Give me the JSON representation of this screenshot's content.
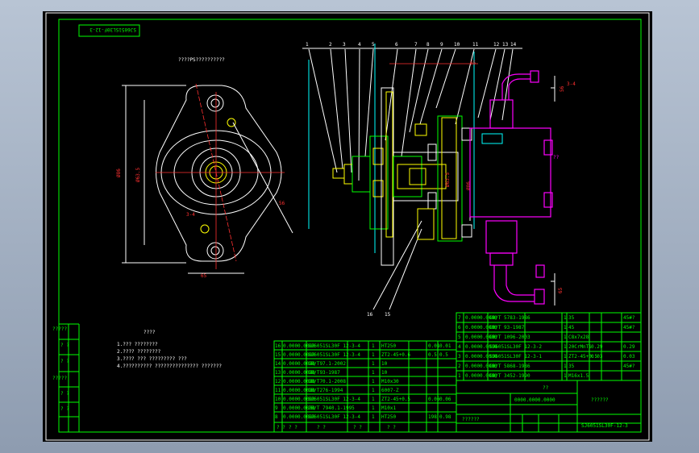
{
  "drawing_code": "SJ6051SL30F-12-3",
  "top_view_title": "????PS??????????",
  "tech_req_title": "????",
  "tech_req_lines": [
    "1.??? ????????",
    "2.???? ????????",
    "3.???? ??? ????????? ???",
    "4.?????????? ??????????????? ???????"
  ],
  "pump_label": "??",
  "part_numbers": [
    "1",
    "2",
    "3",
    "4",
    "5",
    "6",
    "7",
    "8",
    "9",
    "10",
    "11",
    "12",
    "13",
    "14"
  ],
  "leader_numbers": [
    "16",
    "15"
  ],
  "dims": {
    "a": "65",
    "b": "Ø63.5",
    "c": "Ø86",
    "d": "56",
    "e": "3-4"
  },
  "side_tags": [
    "?????",
    "? ?",
    "? ?",
    "? ?",
    "?????",
    "? ?",
    "? ?"
  ],
  "bom_left": [
    {
      "no": "16",
      "code": "0.0000.0000",
      "name": "SJ6051SL30F 12-3-4",
      "qty": "1",
      "mat": "HT250",
      "wt": "0.01",
      "tot": "0.01"
    },
    {
      "no": "15",
      "code": "0.0000.0000",
      "name": "SJ6051SL30F 12-3-4",
      "qty": "1",
      "mat": "ZT2-45+0.6",
      "wt": "0.5",
      "tot": "0.5"
    },
    {
      "no": "14",
      "code": "0.0000.0000",
      "name": "GB/T97.1-2002",
      "qty": "1",
      "mat": "10",
      "wt": "",
      "tot": ""
    },
    {
      "no": "13",
      "code": "0.0000.0000",
      "name": "GB/T93-1987",
      "qty": "1",
      "mat": "10",
      "wt": "",
      "tot": ""
    },
    {
      "no": "12",
      "code": "0.0000.0000",
      "name": "GB/T70.1-2008",
      "qty": "1",
      "mat": "M10x30",
      "wt": "",
      "tot": ""
    },
    {
      "no": "11",
      "code": "0.0000.0000",
      "name": "GB/T276-1994",
      "qty": "1",
      "mat": "6007-Z",
      "wt": "",
      "tot": ""
    },
    {
      "no": "10",
      "code": "0.0000.0000",
      "name": "SJ6051SL30F 12-3-4",
      "qty": "1",
      "mat": "ZT2-45+0.5",
      "wt": "0.06",
      "tot": "0.06"
    },
    {
      "no": "9",
      "code": "0.0000.0000",
      "name": "JB/T 7940.1-1995",
      "qty": "1",
      "mat": "M10x1",
      "wt": "",
      "tot": ""
    },
    {
      "no": "8",
      "code": "0.0000.0000",
      "name": "SJ6051SL30F 12-3-4",
      "qty": "1",
      "mat": "HT250",
      "wt": "198",
      "tot": "0.98"
    }
  ],
  "bom_right": [
    {
      "no": "7",
      "code": "0.0000.0000",
      "name": "GB/T 5783-1986",
      "qty": "1",
      "mat": "35",
      "wt": "",
      "tot": "45#?"
    },
    {
      "no": "6",
      "code": "0.0000.0000",
      "name": "GB/T 93-1987",
      "qty": "1",
      "mat": "45",
      "wt": "",
      "tot": "45#?"
    },
    {
      "no": "5",
      "code": "0.0000.0000",
      "name": "GB/T 1096-2003",
      "qty": "1",
      "mat": "C8x7x28",
      "wt": "",
      "tot": ""
    },
    {
      "no": "4",
      "code": "0.0000.0000",
      "name": "SJ6051SL30F 12-3-2",
      "qty": "1",
      "mat": "20CrMnTi",
      "wt": "0.29",
      "tot": "0.29"
    },
    {
      "no": "3",
      "code": "0.0000.0000",
      "name": "SJ6051SL30F 12-3-1",
      "qty": "1",
      "mat": "ZT2-45+0.5",
      "wt": "0.03",
      "tot": "0.03"
    },
    {
      "no": "2",
      "code": "0.0000.0000",
      "name": "GB/T 5868-1986",
      "qty": "1",
      "mat": "35",
      "wt": "",
      "tot": "45#?"
    },
    {
      "no": "1",
      "code": "0.0000.0000",
      "name": "GB/T 3452-1990",
      "qty": "1",
      "mat": "M16x1.5",
      "wt": "",
      "tot": ""
    }
  ],
  "title_block": {
    "company": "??????",
    "drawing_no": "SJ6051SL30F-12-3",
    "name": "??????",
    "code_box": "0000.0000.0000"
  },
  "header_row": [
    "? ?",
    "? ?",
    "? ?",
    "? ?",
    "? ?",
    "? ?",
    "? ?",
    "? ?"
  ]
}
